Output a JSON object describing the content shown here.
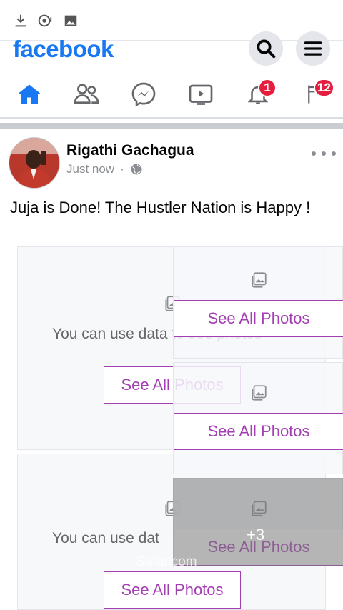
{
  "status_bar": {
    "icons": [
      "download-icon",
      "sync-icon",
      "image-icon"
    ]
  },
  "header": {
    "logo": "facebook",
    "search_icon": "search-icon",
    "menu_icon": "menu-icon"
  },
  "nav": {
    "items": [
      {
        "name": "home",
        "icon": "home-icon",
        "active": true
      },
      {
        "name": "friends",
        "icon": "friends-icon"
      },
      {
        "name": "messenger",
        "icon": "messenger-icon"
      },
      {
        "name": "watch",
        "icon": "watch-icon"
      },
      {
        "name": "notifications",
        "icon": "bell-icon",
        "badge": "1"
      },
      {
        "name": "menu",
        "icon": "flag-icon",
        "badge": "12"
      }
    ],
    "accent": "#1877f2",
    "badge_color": "#e41e3f"
  },
  "post": {
    "author": "Rigathi Gachagua",
    "time": "Just now",
    "separator": "·",
    "privacy_icon": "globe-icon",
    "text": "Juja is Done! The Hustler Nation is Happy !",
    "tiles": {
      "data_message": "You can use data to see photos",
      "data_message_short": "You can use dat",
      "see_all": "See All Photos",
      "more_count": "+3",
      "watermark": "Safaricom"
    }
  }
}
